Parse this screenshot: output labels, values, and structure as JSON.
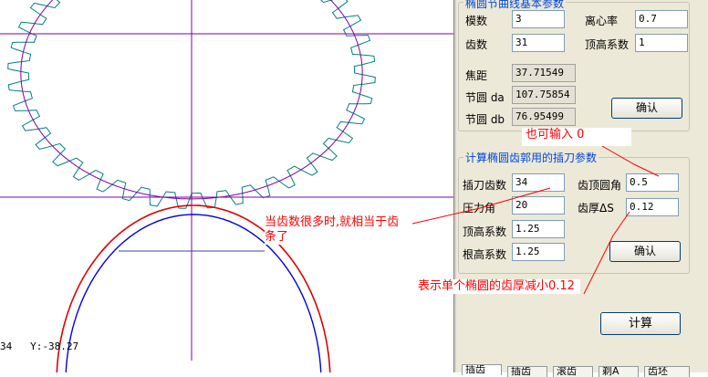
{
  "status": {
    "coord_prefix": "34",
    "y_readout": "Y:-38.27"
  },
  "group1": {
    "title": "椭圆节曲线基本参数",
    "modulus_label": "模数",
    "modulus_value": "3",
    "eccentricity_label": "离心率",
    "eccentricity_value": "0.7",
    "teeth_label": "齿数",
    "teeth_value": "31",
    "addendum_label": "顶高系数",
    "addendum_value": "1",
    "focal_label": "焦距",
    "focal_value": "37.71549",
    "pitch_a_label": "节圆 da",
    "pitch_a_value": "107.75854",
    "pitch_b_label": "节圆 db",
    "pitch_b_value": "76.95499",
    "confirm_label": "确认"
  },
  "group2": {
    "title": "计算椭圆齿郭用的插刀参数",
    "cutter_teeth_label": "插刀齿数",
    "cutter_teeth_value": "34",
    "tip_round_label": "齿顶圆角",
    "tip_round_value": "0.5",
    "pressure_label": "压力角",
    "pressure_value": "20",
    "thickness_label": "齿厚ΔS",
    "thickness_value": "0.12",
    "addendum_label": "顶高系数",
    "addendum_value": "1.25",
    "dedendum_label": "根高系数",
    "dedendum_value": "1.25",
    "confirm_label": "确认"
  },
  "calc_label": "计算",
  "tabs": [
    "插齿",
    "插齿",
    "滚齿",
    "剃A",
    "齿坯"
  ],
  "annotations": {
    "zero_note": "也可输入 0",
    "rack_note": "当齿数很多时,就相当于齿条了",
    "thickness_note": "表示单个椭圆的齿厚减小0.12"
  },
  "colors": {
    "gear_teal": "#008080",
    "axis_purple": "#8000a0",
    "cutter_red": "#e00000",
    "cutter_blue": "#0000e0",
    "annotation_red": "#ff0000",
    "label_blue": "#0046d5"
  }
}
